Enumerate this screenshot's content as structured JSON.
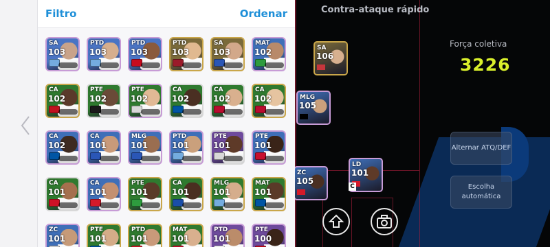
{
  "panel": {
    "filter_label": "Filtro",
    "order_label": "Ordenar"
  },
  "cards": [
    {
      "pos": "SA",
      "ovr": "103",
      "bg": "#4a74c4",
      "edge": "#c79bd6",
      "flag": "#74acdf",
      "face": "#c9a38a"
    },
    {
      "pos": "PTD",
      "ovr": "103",
      "bg": "#4a74c4",
      "edge": "#c79bd6",
      "flag": "#74acdf",
      "face": "#d6ae8d"
    },
    {
      "pos": "PTD",
      "ovr": "103",
      "bg": "#4a74c4",
      "edge": "#c79bd6",
      "flag": "#c60b1e",
      "face": "#8a5a3c"
    },
    {
      "pos": "PTD",
      "ovr": "103",
      "bg": "#7a6a3a",
      "edge": "#c9a64a",
      "flag": "#9a1a2a",
      "face": "#e0b990"
    },
    {
      "pos": "SA",
      "ovr": "103",
      "bg": "#7a6a3a",
      "edge": "#c9a64a",
      "flag": "#2a56b6",
      "face": "#d2a88a"
    },
    {
      "pos": "MAT",
      "ovr": "102",
      "bg": "#3f6fb8",
      "edge": "#c79bd6",
      "flag": "#2e9b3e",
      "face": "#b88a6a"
    },
    {
      "pos": "CA",
      "ovr": "102",
      "bg": "#2f7a2f",
      "edge": "#c9a64a",
      "flag": "#c1121f",
      "face": "#5a3a2a"
    },
    {
      "pos": "PTE",
      "ovr": "102",
      "bg": "#2f7a2f",
      "edge": "#d8d8d8",
      "flag": "#1a1a1a",
      "face": "#6a4a38"
    },
    {
      "pos": "PTE",
      "ovr": "102",
      "bg": "#2f7a2f",
      "edge": "#c79bd6",
      "flag": "#d8d8d8",
      "face": "#e1b995"
    },
    {
      "pos": "CA",
      "ovr": "102",
      "bg": "#2f7a2f",
      "edge": "#d8d8d8",
      "flag": "#0055a4",
      "face": "#4a2f22"
    },
    {
      "pos": "CA",
      "ovr": "102",
      "bg": "#2f7a2f",
      "edge": "#d8d8d8",
      "flag": "#ba0c2f",
      "face": "#d9b08e"
    },
    {
      "pos": "CA",
      "ovr": "102",
      "bg": "#2f7a2f",
      "edge": "#c9a64a",
      "flag": "#ba0c2f",
      "face": "#e6c4a0"
    },
    {
      "pos": "CA",
      "ovr": "102",
      "bg": "#3f6fb8",
      "edge": "#c79bd6",
      "flag": "#0055a4",
      "face": "#3e2a20"
    },
    {
      "pos": "CA",
      "ovr": "101",
      "bg": "#3f6fb8",
      "edge": "#c79bd6",
      "flag": "#2a56b6",
      "face": "#c99a7a"
    },
    {
      "pos": "MLG",
      "ovr": "101",
      "bg": "#3f6fb8",
      "edge": "#c79bd6",
      "flag": "#2a56b6",
      "face": "#9a6e50"
    },
    {
      "pos": "PTD",
      "ovr": "101",
      "bg": "#3f6fb8",
      "edge": "#c79bd6",
      "flag": "#74acdf",
      "face": "#caa07c"
    },
    {
      "pos": "PTE",
      "ovr": "101",
      "bg": "#6e4a9c",
      "edge": "#d8d8d8",
      "flag": "#d8d8d8",
      "face": "#5e3a28"
    },
    {
      "pos": "PTE",
      "ovr": "101",
      "bg": "#3f6fb8",
      "edge": "#c79bd6",
      "flag": "#c8102e",
      "face": "#3a2418"
    },
    {
      "pos": "CA",
      "ovr": "101",
      "bg": "#2f7a2f",
      "edge": "#d8d8d8",
      "flag": "#ce1126",
      "face": "#a5704e"
    },
    {
      "pos": "CA",
      "ovr": "101",
      "bg": "#3f6fb8",
      "edge": "#c79bd6",
      "flag": "#d41a2a",
      "face": "#c49070"
    },
    {
      "pos": "PTE",
      "ovr": "101",
      "bg": "#2f7a2f",
      "edge": "#c9a64a",
      "flag": "#2e9b3e",
      "face": "#5a3a28"
    },
    {
      "pos": "CA",
      "ovr": "101",
      "bg": "#2f7a2f",
      "edge": "#c9a64a",
      "flag": "#1a4ea8",
      "face": "#4a2e20"
    },
    {
      "pos": "MLG",
      "ovr": "101",
      "bg": "#2f7a2f",
      "edge": "#c9a64a",
      "flag": "#74acdf",
      "face": "#d5ad8c"
    },
    {
      "pos": "MAT",
      "ovr": "101",
      "bg": "#2f7a2f",
      "edge": "#c9a64a",
      "flag": "#0055a4",
      "face": "#5a3a28"
    },
    {
      "pos": "ZC",
      "ovr": "101",
      "bg": "#3f6fb8",
      "edge": "#c79bd6",
      "flag": "#d8d8d8",
      "face": "#c69a78"
    },
    {
      "pos": "PTE",
      "ovr": "101",
      "bg": "#2f7a2f",
      "edge": "#c9a64a",
      "flag": "#0055a4",
      "face": "#d4ac88"
    },
    {
      "pos": "PTD",
      "ovr": "101",
      "bg": "#2f7a2f",
      "edge": "#c9a64a",
      "flag": "#d41a2a",
      "face": "#c99a7a"
    },
    {
      "pos": "MAT",
      "ovr": "101",
      "bg": "#2f7a2f",
      "edge": "#c9a64a",
      "flag": "#c8102e",
      "face": "#d9b08e"
    },
    {
      "pos": "PTD",
      "ovr": "101",
      "bg": "#6e4a9c",
      "edge": "#c79bd6",
      "flag": "#ffffff",
      "face": "#bb8c6a"
    },
    {
      "pos": "PTE",
      "ovr": "100",
      "bg": "#6e4a9c",
      "edge": "#c79bd6",
      "flag": "#c60b1e",
      "face": "#3a2418"
    }
  ],
  "field": {
    "tactic_title": "Contra-ataque rápido",
    "strength_label": "Força coletiva",
    "strength_value": "3226",
    "toggle_atk_def_label": "Alternar ATQ/DEF",
    "auto_select_label": "Escolha automática",
    "colors": {
      "strength": "#d9ef2b",
      "accent": "#1e8fd8"
    },
    "players": [
      {
        "pos": "SA",
        "ovr": "106",
        "bg": "#7a6a3a",
        "edge": "#c9a64a",
        "face": "#d7b08f",
        "flag": "#c6363c"
      },
      {
        "pos": "MLG",
        "ovr": "105",
        "bg": "#3f6fb8",
        "edge": "#c79bd6",
        "face": "#caa07c",
        "flag": "#000000"
      },
      {
        "pos": "ZC",
        "ovr": "105",
        "bg": "#3f6fb8",
        "edge": "#c79bd6",
        "face": "#4a2f22",
        "flag": "#d41a2a"
      },
      {
        "pos": "LD",
        "ovr": "101",
        "bg": "#3f6fb8",
        "edge": "#c79bd6",
        "face": "#5e3a28",
        "flag": "#d41a2a"
      }
    ],
    "captain_mark": "C",
    "icons": [
      "upload-icon",
      "camera-icon"
    ]
  }
}
